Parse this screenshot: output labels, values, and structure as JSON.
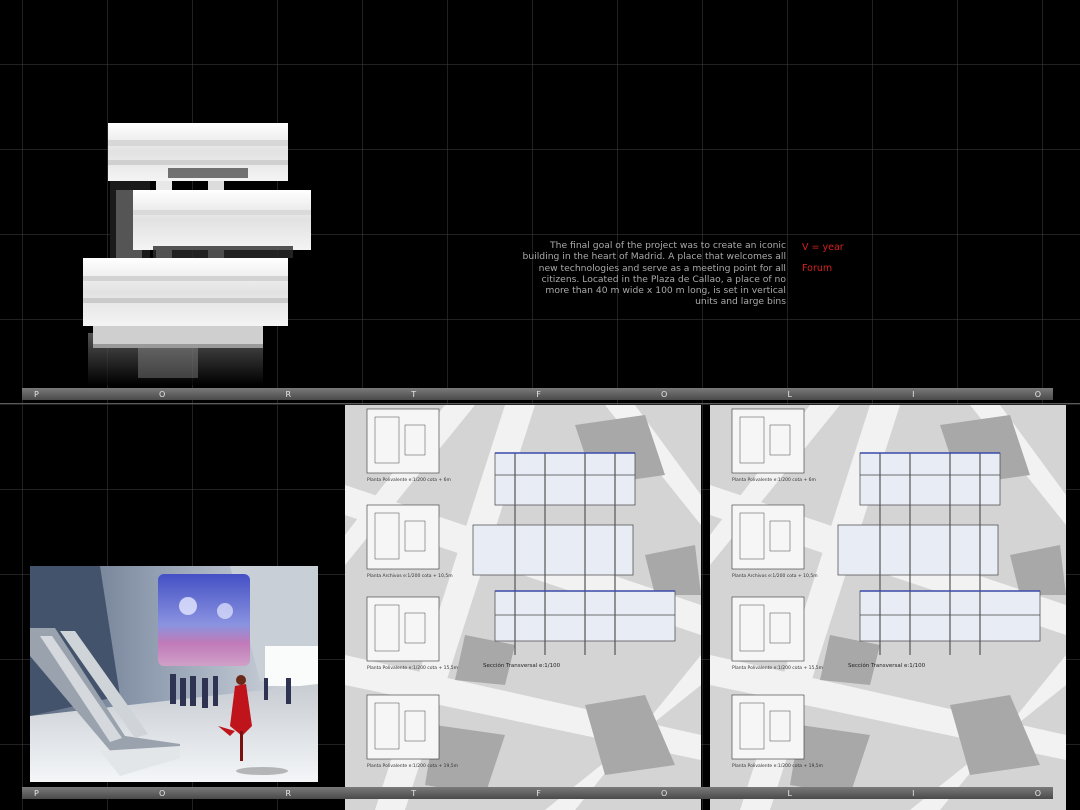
{
  "description": "The final goal of the project was to create an iconic building in the heart of Madrid. A place that welcomes all new technologies and serve as a meeting point for all citizens. Located in the Plaza de Callao, a place of no more than 40 m wide x 100 m long, is set in vertical units and large bins",
  "meta": {
    "year_label": "V = year",
    "tag": "Forum"
  },
  "banner_letters": [
    "P",
    "O",
    "R",
    "T",
    "F",
    "O",
    "L",
    "I",
    "O"
  ],
  "sheet": {
    "section_label": "Sección Transversal  e:1/100",
    "plan_labels": [
      "Planta Polivalente  e:1/200    cota + 6m",
      "Planta Archivos  e:1/200    cota + 10,5m",
      "Planta Polivalente  e:1/200    cota + 15,5m",
      "Planta Polivalente  e:1/200    cota + 19,5m"
    ]
  },
  "colors": {
    "background": "#000000",
    "grid": "#3c3c3c",
    "banner": "#5e5e5e",
    "accent_red": "#d62020",
    "text_grey": "#a9a9a9"
  }
}
